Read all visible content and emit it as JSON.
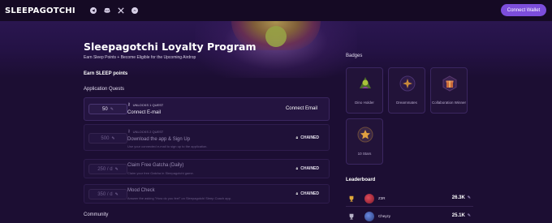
{
  "nav": {
    "logo": "SLEEPAGOTCHI",
    "socials": [
      "telegram-icon",
      "discord-icon",
      "x-icon",
      "messenger-icon"
    ],
    "connect_label": "Connect Wallet"
  },
  "hero": {
    "title": "Sleepagotchi Loyalty Program",
    "subtitle": "Earn Sleep Points + Become Eligible for the Upcoming Airdrop"
  },
  "earn_title": "Earn SLEEP points",
  "application_quests": {
    "label": "Application Quests",
    "items": [
      {
        "points": "50",
        "unlock": "UNLOCKS 1 QUEST",
        "title": "Connect E-mail",
        "desc": "",
        "action": "Connect Email",
        "locked": false
      },
      {
        "points": "500",
        "unlock": "UNLOCKS 2 QUEST",
        "title": "Download the app & Sign Up",
        "desc": "Use your connected e-mail to sign up to the application.",
        "action": "CHAINED",
        "locked": true
      },
      {
        "points": "250 / d",
        "unlock": "",
        "title": "Claim Free Gatcha (Daily)",
        "desc": "Claim your free Gatcha in Sleepagotchi game.",
        "action": "CHAINED",
        "locked": true
      },
      {
        "points": "350 / d",
        "unlock": "",
        "title": "Mood Check",
        "desc": "Answer the asking \"How do you feel\" on Sleepagotchi Sleep Coach app.",
        "action": "CHAINED",
        "locked": true
      }
    ]
  },
  "community_label": "Community",
  "badges": {
    "label": "Badges",
    "items": [
      {
        "name": "Dino Holder",
        "icon": "dino-icon"
      },
      {
        "name": "Dreammates",
        "icon": "sparkle-icon"
      },
      {
        "name": "Collaboration Winner",
        "icon": "gift-icon"
      },
      {
        "name": "10 Stars",
        "icon": "star-icon"
      }
    ]
  },
  "leaderboard": {
    "label": "Leaderboard",
    "rows": [
      {
        "name": "Z3R",
        "score": "26.3K",
        "trophy": "gold-trophy-icon"
      },
      {
        "name": "Cheyzy",
        "score": "25.1K",
        "trophy": "silver-trophy-icon"
      }
    ]
  },
  "colors": {
    "accent": "#7c4ddb",
    "background": "#1c0e33"
  }
}
